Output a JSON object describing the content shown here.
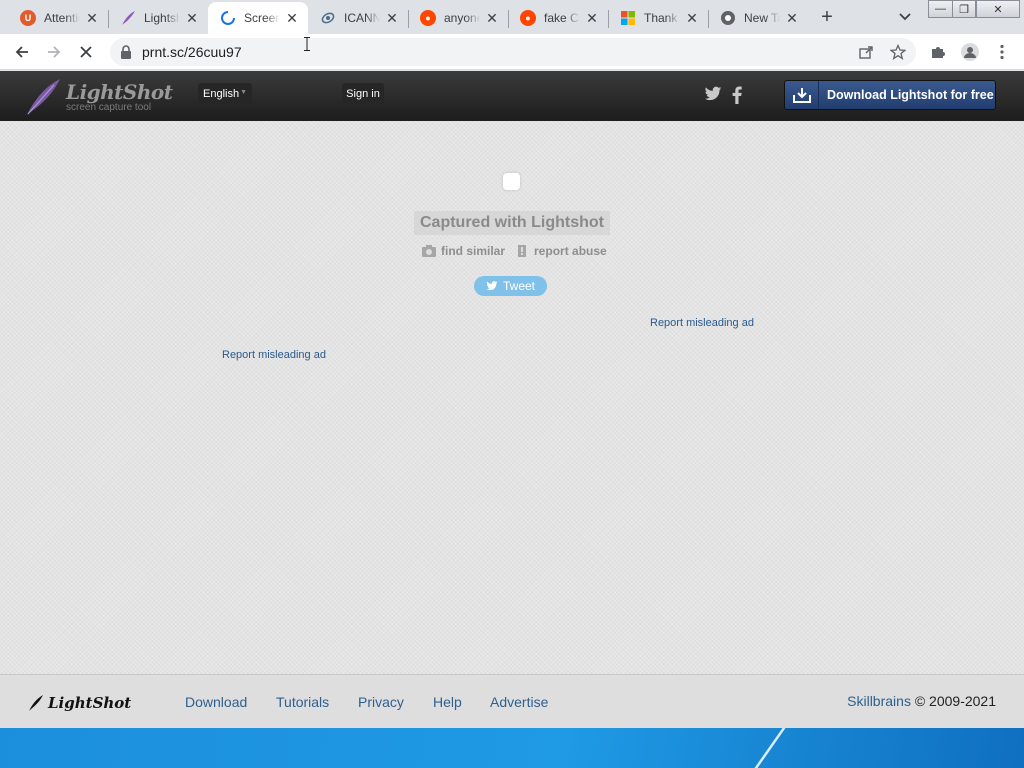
{
  "browser": {
    "tabs": [
      {
        "title": "Attention",
        "favicon": "ublock-icon",
        "color": "#e25b2b"
      },
      {
        "title": "Lightshot",
        "favicon": "feather-icon",
        "color": "#8b5bb5"
      },
      {
        "title": "Screenshot",
        "favicon": "loading-spinner-icon",
        "color": "#1a73e8"
      },
      {
        "title": "ICANN",
        "favicon": "icann-icon",
        "color": "#4a6b8a"
      },
      {
        "title": "anyone",
        "favicon": "reddit-icon",
        "color": "#ff4500"
      },
      {
        "title": "fake Cr",
        "favicon": "reddit-icon",
        "color": "#ff4500"
      },
      {
        "title": "Thank",
        "favicon": "microsoft-icon",
        "color": "#f25022"
      },
      {
        "title": "New Tab",
        "favicon": "chrome-icon",
        "color": "#5f6368"
      }
    ],
    "url": "prnt.sc/26cuu97"
  },
  "header": {
    "brand": "LightShot",
    "tagline": "screen capture tool",
    "language": "English",
    "signin": "Sign in",
    "download_button": "Download Lightshot for free"
  },
  "main": {
    "captured_label": "Captured with Lightshot",
    "find_similar": "find similar",
    "report_abuse": "report abuse",
    "tweet": "Tweet",
    "report_ad_right": "Report misleading ad",
    "report_ad_left": "Report misleading ad"
  },
  "footer": {
    "brand": "LightShot",
    "links": [
      "Download",
      "Tutorials",
      "Privacy",
      "Help",
      "Advertise"
    ],
    "company": "Skillbrains",
    "copyright": "© 2009-2021"
  }
}
